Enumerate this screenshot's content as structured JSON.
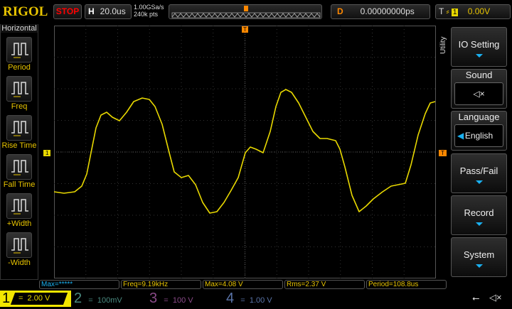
{
  "header": {
    "logo": "RIGOL",
    "run_state": "STOP",
    "h_label": "H",
    "timebase": "20.0us",
    "sample_rate": "1.00GSa/s",
    "memory_depth": "240k pts",
    "d_label": "D",
    "delay": "0.00000000ps",
    "t_label": "T",
    "trigger_source": "1",
    "trigger_level": "0.00V"
  },
  "left_menu": {
    "title": "Horizontal",
    "items": [
      {
        "label": "Period",
        "icon": "period-icon"
      },
      {
        "label": "Freq",
        "icon": "freq-icon"
      },
      {
        "label": "Rise Time",
        "icon": "rise-time-icon"
      },
      {
        "label": "Fall Time",
        "icon": "fall-time-icon"
      },
      {
        "label": "+Width",
        "icon": "positive-width-icon"
      },
      {
        "label": "-Width",
        "icon": "negative-width-icon"
      }
    ]
  },
  "right_menu": {
    "title": "Utility",
    "io_setting": "IO Setting",
    "sound": "Sound",
    "sound_icon": "speaker-muted-icon",
    "language": "Language",
    "language_value": "English",
    "pass_fail": "Pass/Fail",
    "record": "Record",
    "system": "System"
  },
  "markers": {
    "ch1": "1",
    "trigger": "T"
  },
  "measurements": [
    "Max=*****",
    "Freq=9.19kHz",
    "Max=4.08 V",
    "Rms=2.37 V",
    "Period=108.8us"
  ],
  "channels": [
    {
      "num": "1",
      "scale": "2.00 V",
      "color": "#f2e600"
    },
    {
      "num": "2",
      "scale": "100mV",
      "color": "#1a8a7a"
    },
    {
      "num": "3",
      "scale": "100 V",
      "color": "#a0309a"
    },
    {
      "num": "4",
      "scale": "1.00 V",
      "color": "#2050a0"
    }
  ],
  "colors": {
    "trace": "#e8d800",
    "accent": "#f80",
    "menu_arrow": "#1ab0f0"
  }
}
